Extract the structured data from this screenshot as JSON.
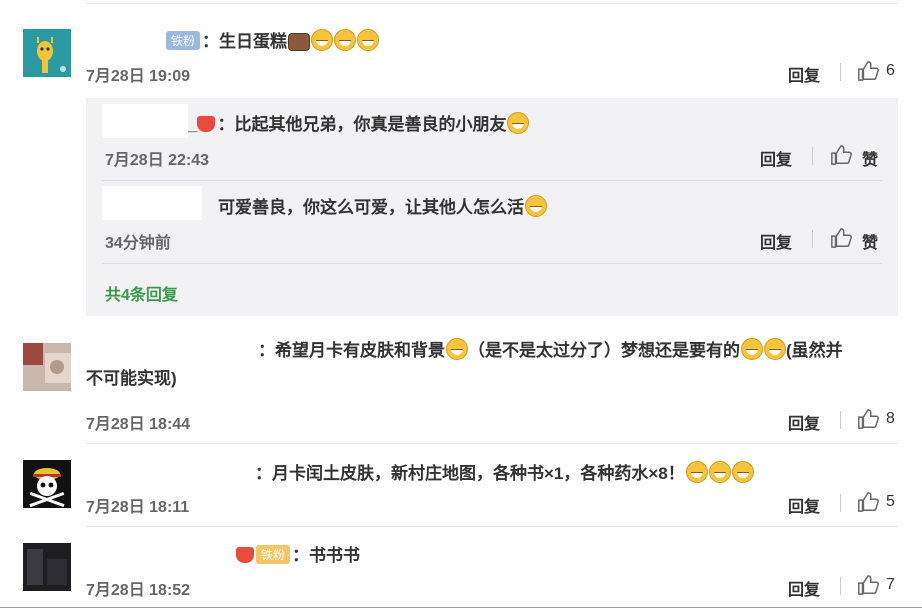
{
  "labels": {
    "reply": "回复",
    "like": "赞",
    "more_replies": "共4条回复"
  },
  "comments": [
    {
      "badge": "铁粉",
      "text": "：生日蛋糕",
      "time": "7月28日 19:09",
      "likes": "6"
    },
    {
      "text": "：希望月卡有皮肤和背景",
      "text2": "（是不是太过分了）梦想还是要有的",
      "text3": "(虽然并",
      "text_wrap": "不可能实现)",
      "time": "7月28日 18:44",
      "likes": "8"
    },
    {
      "text": "：月卡闰土皮肤，新村庄地图，各种书×1，各种药水×8！",
      "time": "7月28日 18:11",
      "likes": "5"
    },
    {
      "badge": "铁粉",
      "text": "：书书书",
      "time": "7月28日 18:52",
      "likes": "7"
    }
  ],
  "replies": [
    {
      "prefix": "_",
      "text": "：比起其他兄弟，你真是善良的小朋友",
      "time": "7月28日 22:43"
    },
    {
      "text": "可爱善良，你这么可爱，让其他人怎么活",
      "time": "34分钟前"
    }
  ],
  "colors": {
    "link_green": "#3a9a4a",
    "reply_bg": "#f2f2f5",
    "badge_blue": "#9ab9de",
    "badge_gold": "#f3c763"
  },
  "icons": [
    "thumbs-up-icon",
    "laughing-emoji-icon",
    "cake-icon",
    "crown-icon"
  ]
}
